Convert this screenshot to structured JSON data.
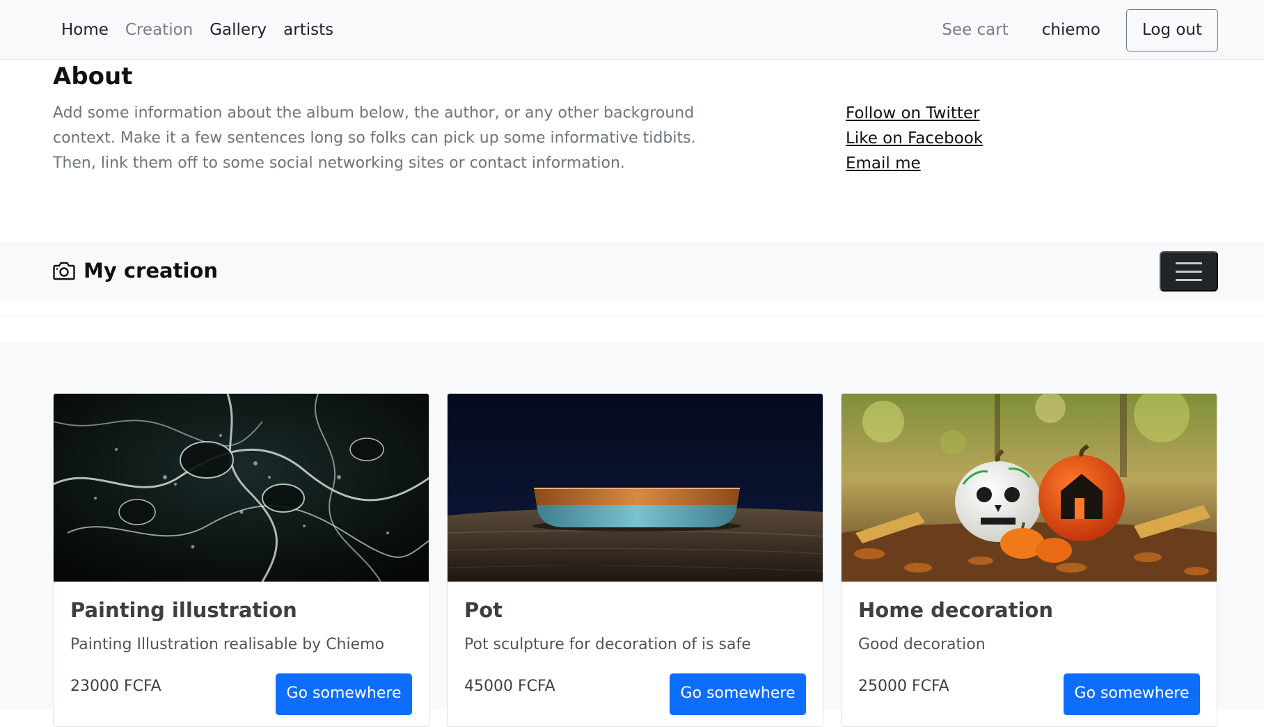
{
  "navbar": {
    "links": [
      {
        "label": "Home"
      },
      {
        "label": "Creation"
      },
      {
        "label": "Gallery"
      },
      {
        "label": "artists"
      }
    ],
    "cart_label": "See cart",
    "user_label": "chiemo",
    "logout_label": "Log out"
  },
  "about": {
    "title": "About",
    "text": "Add some information about the album below, the author, or any other background context. Make it a few sentences long so folks can pick up some informative tidbits. Then, link them off to some social networking sites or contact information.",
    "links": [
      {
        "label": "Follow on Twitter"
      },
      {
        "label": "Like on Facebook"
      },
      {
        "label": "Email me"
      }
    ]
  },
  "creation_bar": {
    "title": "My creation",
    "icon": "camera-icon",
    "toggler_icon": "hamburger-menu-icon"
  },
  "cards": [
    {
      "title": "Painting illustration",
      "text": "Painting Illustration realisable by Chiemo",
      "price": "23000 FCFA",
      "button": "Go somewhere",
      "image": "abstract-black-white-marbled-paint"
    },
    {
      "title": "Pot",
      "text": "Pot sculpture for decoration of is safe",
      "price": "45000 FCFA",
      "button": "Go somewhere",
      "image": "blue-wooden-bowl-on-table"
    },
    {
      "title": "Home decoration",
      "text": "Good decoration",
      "price": "25000 FCFA",
      "button": "Go somewhere",
      "image": "painted-halloween-pumpkins-autumn-leaves"
    }
  ],
  "colors": {
    "primary": "#0d6efd",
    "dark": "#212529",
    "light_bg": "#f8f9fa",
    "muted_text": "#6c757d"
  }
}
